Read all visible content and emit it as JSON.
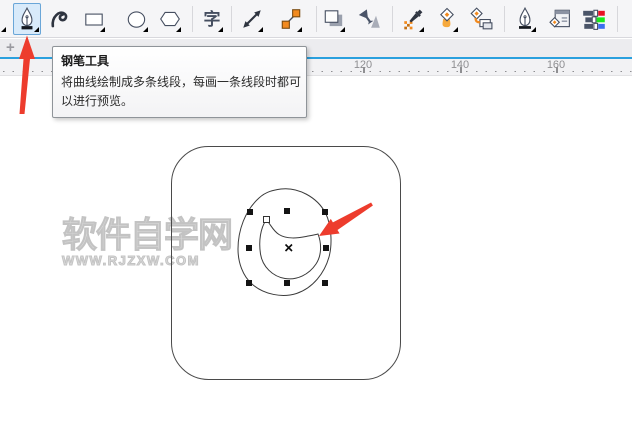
{
  "toolbar": {
    "text_tool_glyph": "字",
    "tools": [
      {
        "name": "partial-tool-flyout",
        "partial": true
      },
      {
        "name": "pen-tool",
        "selected": true
      },
      {
        "name": "artistic-media-tool"
      },
      {
        "name": "rectangle-tool"
      },
      {
        "name": "ellipse-tool"
      },
      {
        "name": "polygon-tool"
      },
      {
        "separator": true
      },
      {
        "name": "text-tool"
      },
      {
        "separator": true
      },
      {
        "name": "dimension-tool"
      },
      {
        "name": "connector-tool"
      },
      {
        "separator": true
      },
      {
        "name": "drop-shadow-tool"
      },
      {
        "name": "transparency-tool"
      },
      {
        "separator": true
      },
      {
        "name": "color-eyedropper-tool"
      },
      {
        "name": "fill-tool"
      },
      {
        "name": "smart-fill-tool"
      },
      {
        "separator": true
      },
      {
        "name": "outline-pen-tool"
      },
      {
        "name": "outline-dialog-tool"
      },
      {
        "name": "color-settings-tool"
      },
      {
        "separator": true
      }
    ]
  },
  "tabstrip": {
    "add_label": "+"
  },
  "ruler": {
    "ticks": [
      "120",
      "140",
      "160"
    ]
  },
  "tooltip": {
    "title": "钢笔工具",
    "body": "将曲线绘制成多条线段，每画一条线段时都可以进行预览。"
  },
  "watermark": {
    "line1": "软件自学网",
    "line2": "WWW.RJZXW.COM"
  },
  "colors": {
    "selection_bg": "#d8eafa",
    "selection_border": "#6aa6d8",
    "accent_blue_line": "#2aa0de",
    "annotation_red": "#ed3c2d",
    "icon_slate": "#454e60",
    "icon_orange": "#f28a1f",
    "bar_red": "#e81123",
    "bar_green": "#1ae81a",
    "bar_blue": "#3a6ff0"
  }
}
